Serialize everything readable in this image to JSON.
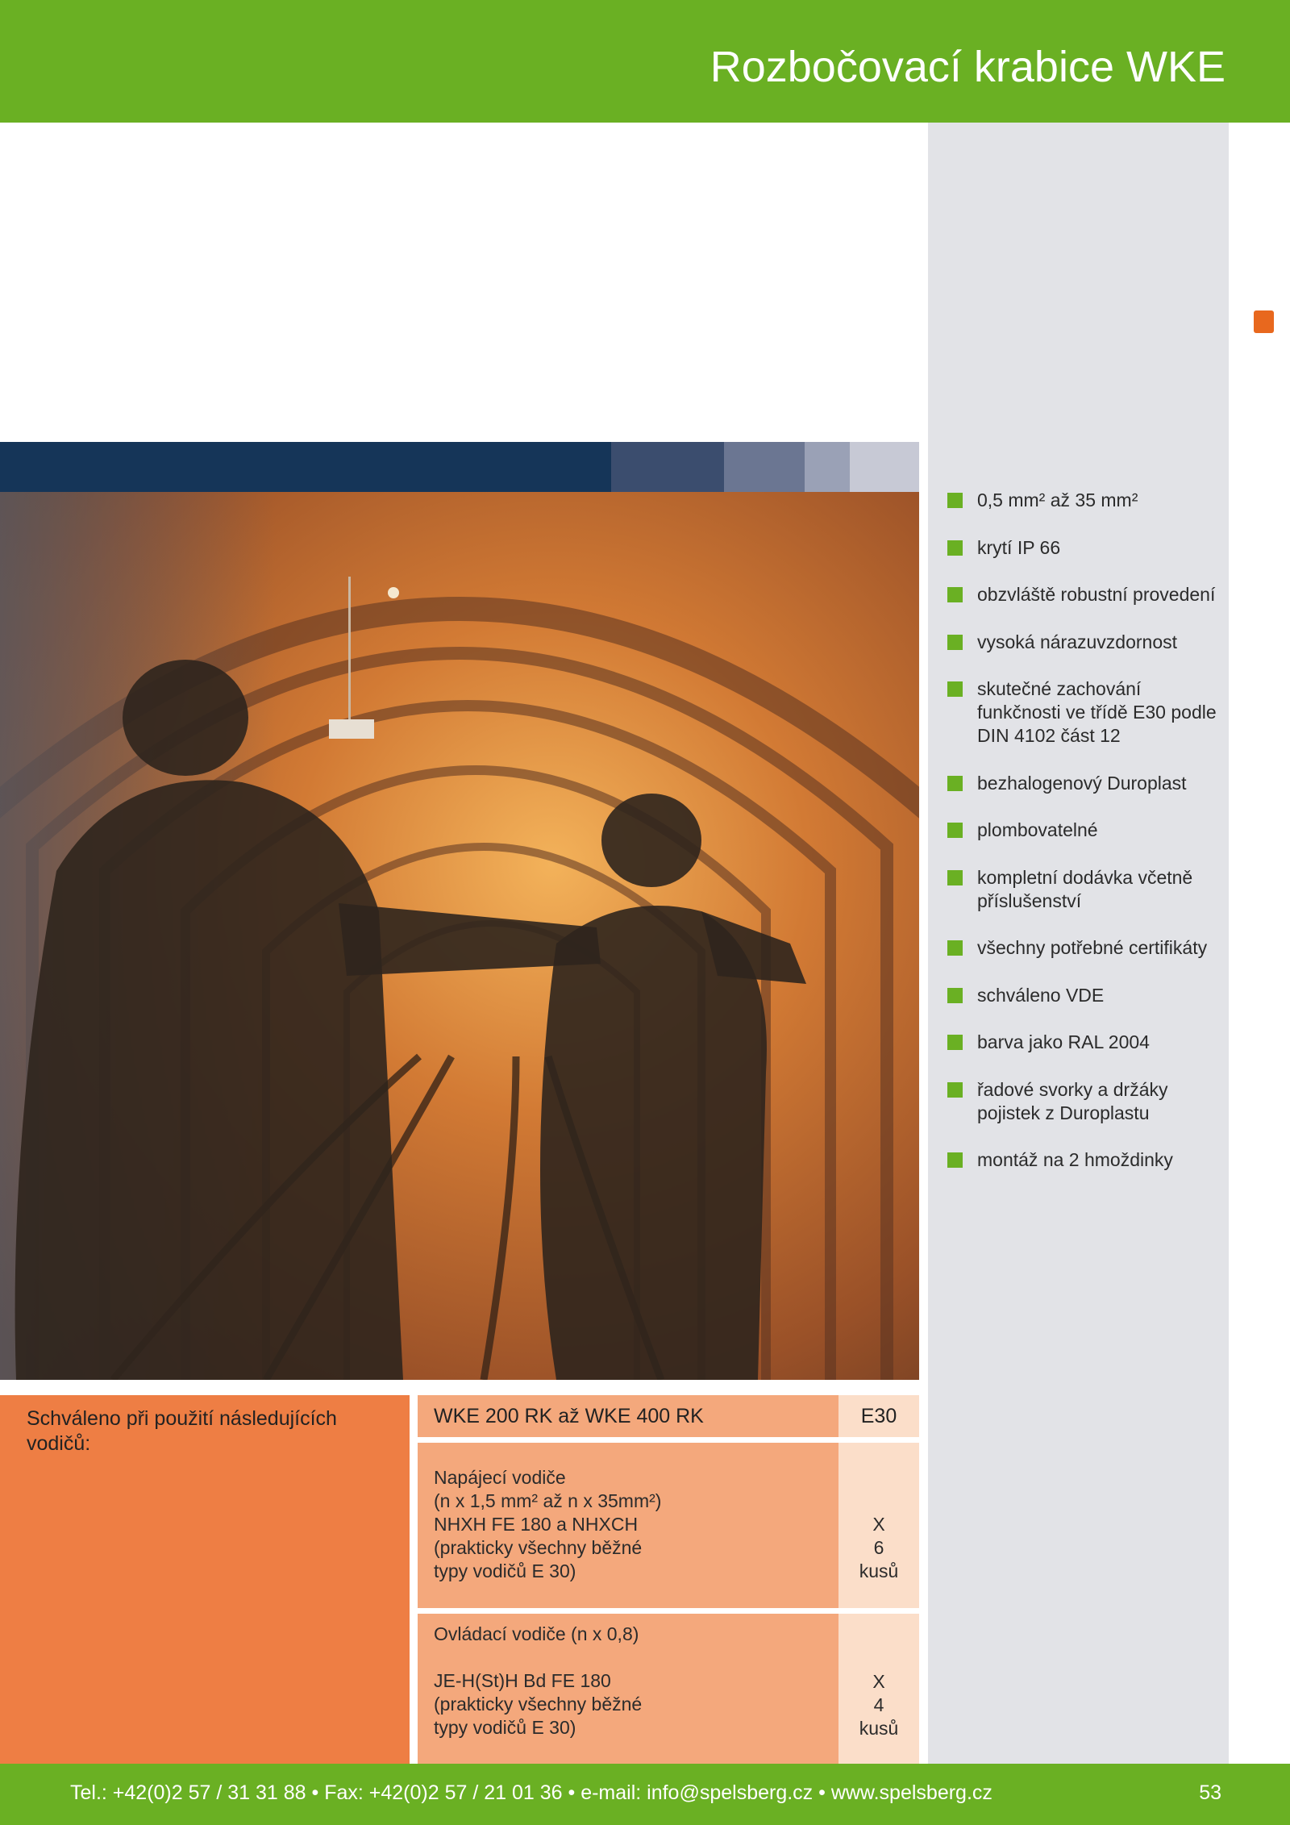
{
  "header": {
    "title": "Rozbočovací krabice WKE"
  },
  "features": [
    {
      "text": "0,5 mm² až 35 mm²"
    },
    {
      "text": "krytí IP 66"
    },
    {
      "text": "obzvláště robustní provedení"
    },
    {
      "text": "vysoká nárazuvzdornost"
    },
    {
      "text": "skutečné zachování funkčnosti ve třídě E30 podle DIN 4102 část 12"
    },
    {
      "text": "bezhalogenový Duroplast"
    },
    {
      "text": "plombovatelné"
    },
    {
      "text": "kompletní dodávka včetně příslušenství"
    },
    {
      "text": "všechny potřebné certifikáty"
    },
    {
      "text": "schváleno VDE"
    },
    {
      "text": "barva jako RAL 2004"
    },
    {
      "text": "řadové svorky a držáky pojistek z Duroplastu"
    },
    {
      "text": "montáž na 2 hmoždinky"
    }
  ],
  "approval": {
    "label": "Schváleno při použití následujících vodičů:",
    "product": "WKE 200 RK až WKE 400 RK",
    "class": "E30",
    "rows": [
      {
        "description": "Napájecí vodiče\n(n x 1,5 mm² až n x 35mm²)\nNHXH FE 180 a NHXCH\n(prakticky všechny běžné\ntypy vodičů E 30)",
        "value": "X\n6\nkusů"
      },
      {
        "description": "Ovládací vodiče (n x 0,8)\n\nJE-H(St)H Bd FE 180\n(prakticky všechny běžné\ntypy vodičů E 30)",
        "value": "X\n4\nkusů"
      }
    ]
  },
  "footer": {
    "contact": "Tel.: +42(0)2 57 / 31 31 88 • Fax: +42(0)2 57 / 21 01 36 • e-mail: info@spelsberg.cz • www.spelsberg.cz",
    "page_number": "53"
  },
  "colors": {
    "brand_green": "#6ab023",
    "accent_orange": "#ee7e44",
    "table_orange": "#f4a87c",
    "table_light": "#fbdec9",
    "sidebar_grey": "#e2e3e7",
    "navy": "#153558"
  }
}
